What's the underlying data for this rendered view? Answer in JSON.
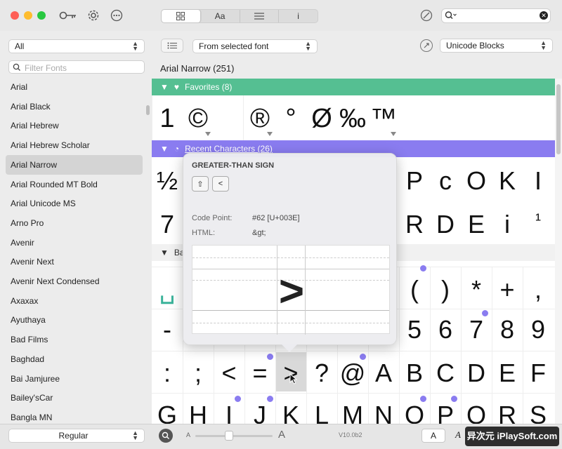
{
  "toolbar": {
    "view_tabs": [
      "",
      "Aa",
      "",
      "i"
    ],
    "search_value": ""
  },
  "filters": {
    "collection": "All",
    "source": "From selected font",
    "blocks": "Unicode Blocks",
    "filter_placeholder": "Filter Fonts"
  },
  "font_title": "Arial Narrow (251)",
  "fonts": [
    "Arial",
    "Arial Black",
    "Arial Hebrew",
    "Arial Hebrew Scholar",
    "Arial Narrow",
    "Arial Rounded MT Bold",
    "Arial Unicode MS",
    "Arno Pro",
    "Avenir",
    "Avenir Next",
    "Avenir Next Condensed",
    "Axaxax",
    "Ayuthaya",
    "Bad Films",
    "Baghdad",
    "Bai Jamjuree",
    "Bailey'sCar",
    "Bangla MN"
  ],
  "selected_font_index": 4,
  "style_select": "Regular",
  "sections": {
    "favorites": "Favorites (8)",
    "recent": "Recent Characters (26)",
    "basic": "Ba"
  },
  "favorites_glyphs": [
    "1",
    "©",
    "",
    "®",
    "°",
    "Ø",
    "‰",
    "™"
  ],
  "recent_row1": [
    "½",
    "P",
    "c",
    "O",
    "K",
    "I"
  ],
  "recent_row2": [
    "7",
    "R",
    "D",
    "E",
    "i",
    "¹"
  ],
  "basic_row1": [
    "␣",
    "(",
    ")",
    "*",
    "+",
    ","
  ],
  "basic_row2": [
    "-",
    "5",
    "6",
    "7",
    "8",
    "9"
  ],
  "basic_row3": [
    ":",
    ";",
    "<",
    "=",
    ">",
    "?",
    "@",
    "A",
    "B",
    "C",
    "D",
    "E",
    "F"
  ],
  "basic_row4": [
    "G",
    "H",
    "I",
    "J",
    "K",
    "L",
    "M",
    "N",
    "O",
    "P",
    "Q",
    "R",
    "S"
  ],
  "popover": {
    "name": "GREATER-THAN SIGN",
    "code_point_label": "Code Point:",
    "code_point_value": "#62 [U+003E]",
    "html_label": "HTML:",
    "html_value": "&gt;",
    "glyph": ">",
    "nav_prev": "<"
  },
  "bottom": {
    "size_small": "A",
    "size_large": "A",
    "version": "V10.0b2",
    "mode_a": "A",
    "mode_b": "A",
    "watermark": "异次元 iPlaySoft.com"
  },
  "colors": {
    "favorites": "#55bf92",
    "recent": "#8a7cf0",
    "accent": "#8a7cf0"
  }
}
